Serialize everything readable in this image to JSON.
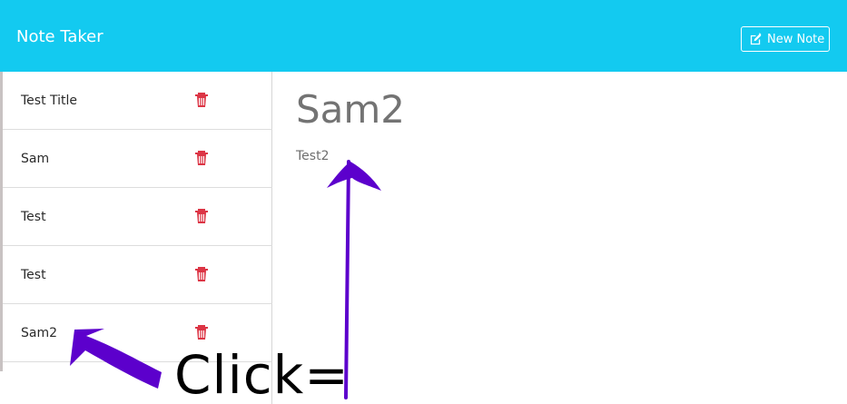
{
  "header": {
    "title": "Note Taker",
    "new_note_label": "New Note"
  },
  "sidebar": {
    "notes": [
      {
        "title": "Test Title"
      },
      {
        "title": "Sam"
      },
      {
        "title": "Test"
      },
      {
        "title": "Test"
      },
      {
        "title": "Sam2"
      }
    ]
  },
  "main": {
    "note_title": "Sam2",
    "note_text": "Test2"
  },
  "annotation": {
    "label": "Click="
  },
  "colors": {
    "header": "#13caf0",
    "delete_icon": "#dc3545",
    "annotation_arrow": "#5c00cc"
  }
}
